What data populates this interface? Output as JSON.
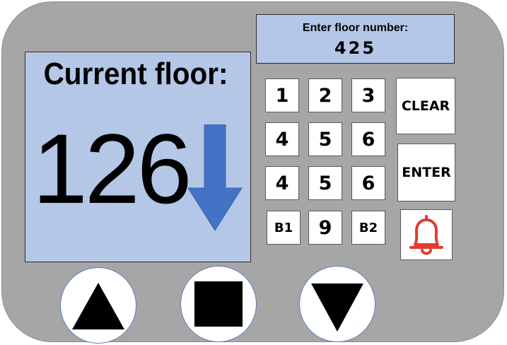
{
  "current_floor": {
    "title": "Current floor:",
    "value": "126",
    "direction": "down",
    "direction_icon": "arrow-down-icon",
    "arrow_color": "#4472c4"
  },
  "floor_entry": {
    "label": "Enter floor number:",
    "value": "425"
  },
  "keypad": {
    "keys": [
      "1",
      "2",
      "3",
      "4",
      "5",
      "6",
      "4",
      "5",
      "6",
      "B1",
      "9",
      "B2"
    ]
  },
  "actions": {
    "clear_label": "CLEAR",
    "enter_label": "ENTER",
    "alarm_icon": "bell-icon",
    "alarm_color": "#e03c31"
  },
  "controls": {
    "up_icon": "triangle-up-icon",
    "stop_icon": "square-stop-icon",
    "down_icon": "triangle-down-icon"
  },
  "colors": {
    "panel": "#a6a6a6",
    "display": "#b4c7e7"
  }
}
